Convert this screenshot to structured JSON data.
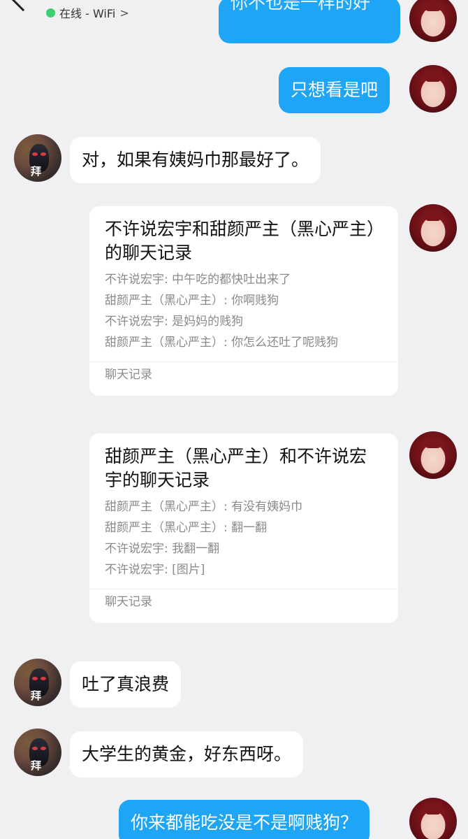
{
  "status": {
    "text": "在线 - WiFi",
    "chevron": ">"
  },
  "messages": {
    "m1_partial": "你不也是一样的好",
    "m2": "只想看是吧",
    "m3": "对，如果有姨妈巾那最好了。",
    "m6": "吐了真浪费",
    "m7": "大学生的黄金，好东西呀。",
    "m8": "你来都能吃没是不是啊贱狗？"
  },
  "card1": {
    "title": "不许说宏宇和甜颜严主（黑心严主）的聊天记录",
    "lines": [
      "不许说宏宇: 中午吃的都快吐出来了",
      "甜颜严主（黑心严主）: 你啊贱狗",
      "不许说宏宇: 是妈妈的贱狗",
      "甜颜严主（黑心严主）: 你怎么还吐了呢贱狗"
    ],
    "footer": "聊天记录"
  },
  "card2": {
    "title": "甜颜严主（黑心严主）和不许说宏宇的聊天记录",
    "lines": [
      "甜颜严主（黑心严主）: 有没有姨妈巾",
      "甜颜严主（黑心严主）: 翻一翻",
      "不许说宏宇: 我翻一翻",
      "不许说宏宇: [图片]"
    ],
    "footer": "聊天记录"
  },
  "avatar_badge": "拜",
  "colors": {
    "bubble_right": "#1ea5f5",
    "background": "#f0f0f3",
    "online": "#3ccf6e"
  },
  "icons": [
    "back-icon",
    "menu-icon",
    "online-status-icon",
    "chevron-right-icon"
  ]
}
